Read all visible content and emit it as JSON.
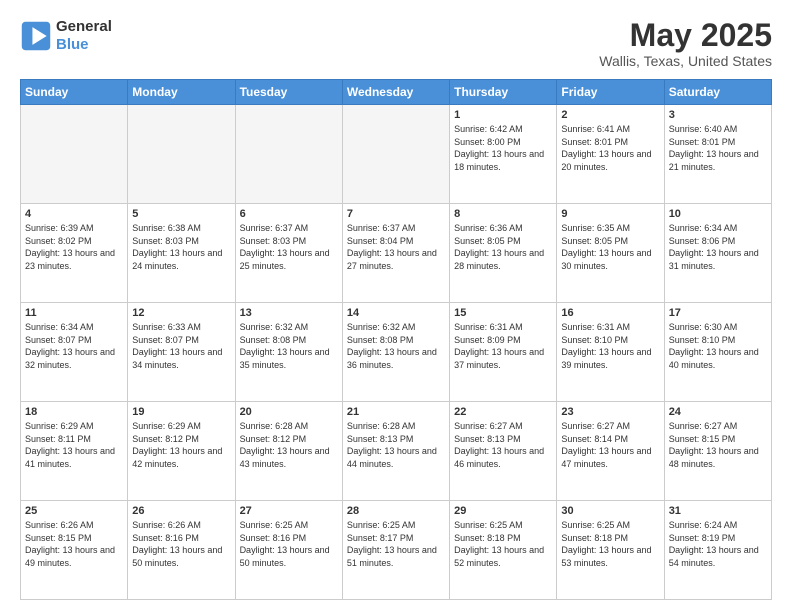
{
  "header": {
    "logo_line1": "General",
    "logo_line2": "Blue",
    "month": "May 2025",
    "location": "Wallis, Texas, United States"
  },
  "days_of_week": [
    "Sunday",
    "Monday",
    "Tuesday",
    "Wednesday",
    "Thursday",
    "Friday",
    "Saturday"
  ],
  "weeks": [
    [
      {
        "day": "",
        "sunrise": "",
        "sunset": "",
        "daylight": ""
      },
      {
        "day": "",
        "sunrise": "",
        "sunset": "",
        "daylight": ""
      },
      {
        "day": "",
        "sunrise": "",
        "sunset": "",
        "daylight": ""
      },
      {
        "day": "",
        "sunrise": "",
        "sunset": "",
        "daylight": ""
      },
      {
        "day": "1",
        "sunrise": "Sunrise: 6:42 AM",
        "sunset": "Sunset: 8:00 PM",
        "daylight": "Daylight: 13 hours and 18 minutes."
      },
      {
        "day": "2",
        "sunrise": "Sunrise: 6:41 AM",
        "sunset": "Sunset: 8:01 PM",
        "daylight": "Daylight: 13 hours and 20 minutes."
      },
      {
        "day": "3",
        "sunrise": "Sunrise: 6:40 AM",
        "sunset": "Sunset: 8:01 PM",
        "daylight": "Daylight: 13 hours and 21 minutes."
      }
    ],
    [
      {
        "day": "4",
        "sunrise": "Sunrise: 6:39 AM",
        "sunset": "Sunset: 8:02 PM",
        "daylight": "Daylight: 13 hours and 23 minutes."
      },
      {
        "day": "5",
        "sunrise": "Sunrise: 6:38 AM",
        "sunset": "Sunset: 8:03 PM",
        "daylight": "Daylight: 13 hours and 24 minutes."
      },
      {
        "day": "6",
        "sunrise": "Sunrise: 6:37 AM",
        "sunset": "Sunset: 8:03 PM",
        "daylight": "Daylight: 13 hours and 25 minutes."
      },
      {
        "day": "7",
        "sunrise": "Sunrise: 6:37 AM",
        "sunset": "Sunset: 8:04 PM",
        "daylight": "Daylight: 13 hours and 27 minutes."
      },
      {
        "day": "8",
        "sunrise": "Sunrise: 6:36 AM",
        "sunset": "Sunset: 8:05 PM",
        "daylight": "Daylight: 13 hours and 28 minutes."
      },
      {
        "day": "9",
        "sunrise": "Sunrise: 6:35 AM",
        "sunset": "Sunset: 8:05 PM",
        "daylight": "Daylight: 13 hours and 30 minutes."
      },
      {
        "day": "10",
        "sunrise": "Sunrise: 6:34 AM",
        "sunset": "Sunset: 8:06 PM",
        "daylight": "Daylight: 13 hours and 31 minutes."
      }
    ],
    [
      {
        "day": "11",
        "sunrise": "Sunrise: 6:34 AM",
        "sunset": "Sunset: 8:07 PM",
        "daylight": "Daylight: 13 hours and 32 minutes."
      },
      {
        "day": "12",
        "sunrise": "Sunrise: 6:33 AM",
        "sunset": "Sunset: 8:07 PM",
        "daylight": "Daylight: 13 hours and 34 minutes."
      },
      {
        "day": "13",
        "sunrise": "Sunrise: 6:32 AM",
        "sunset": "Sunset: 8:08 PM",
        "daylight": "Daylight: 13 hours and 35 minutes."
      },
      {
        "day": "14",
        "sunrise": "Sunrise: 6:32 AM",
        "sunset": "Sunset: 8:08 PM",
        "daylight": "Daylight: 13 hours and 36 minutes."
      },
      {
        "day": "15",
        "sunrise": "Sunrise: 6:31 AM",
        "sunset": "Sunset: 8:09 PM",
        "daylight": "Daylight: 13 hours and 37 minutes."
      },
      {
        "day": "16",
        "sunrise": "Sunrise: 6:31 AM",
        "sunset": "Sunset: 8:10 PM",
        "daylight": "Daylight: 13 hours and 39 minutes."
      },
      {
        "day": "17",
        "sunrise": "Sunrise: 6:30 AM",
        "sunset": "Sunset: 8:10 PM",
        "daylight": "Daylight: 13 hours and 40 minutes."
      }
    ],
    [
      {
        "day": "18",
        "sunrise": "Sunrise: 6:29 AM",
        "sunset": "Sunset: 8:11 PM",
        "daylight": "Daylight: 13 hours and 41 minutes."
      },
      {
        "day": "19",
        "sunrise": "Sunrise: 6:29 AM",
        "sunset": "Sunset: 8:12 PM",
        "daylight": "Daylight: 13 hours and 42 minutes."
      },
      {
        "day": "20",
        "sunrise": "Sunrise: 6:28 AM",
        "sunset": "Sunset: 8:12 PM",
        "daylight": "Daylight: 13 hours and 43 minutes."
      },
      {
        "day": "21",
        "sunrise": "Sunrise: 6:28 AM",
        "sunset": "Sunset: 8:13 PM",
        "daylight": "Daylight: 13 hours and 44 minutes."
      },
      {
        "day": "22",
        "sunrise": "Sunrise: 6:27 AM",
        "sunset": "Sunset: 8:13 PM",
        "daylight": "Daylight: 13 hours and 46 minutes."
      },
      {
        "day": "23",
        "sunrise": "Sunrise: 6:27 AM",
        "sunset": "Sunset: 8:14 PM",
        "daylight": "Daylight: 13 hours and 47 minutes."
      },
      {
        "day": "24",
        "sunrise": "Sunrise: 6:27 AM",
        "sunset": "Sunset: 8:15 PM",
        "daylight": "Daylight: 13 hours and 48 minutes."
      }
    ],
    [
      {
        "day": "25",
        "sunrise": "Sunrise: 6:26 AM",
        "sunset": "Sunset: 8:15 PM",
        "daylight": "Daylight: 13 hours and 49 minutes."
      },
      {
        "day": "26",
        "sunrise": "Sunrise: 6:26 AM",
        "sunset": "Sunset: 8:16 PM",
        "daylight": "Daylight: 13 hours and 50 minutes."
      },
      {
        "day": "27",
        "sunrise": "Sunrise: 6:25 AM",
        "sunset": "Sunset: 8:16 PM",
        "daylight": "Daylight: 13 hours and 50 minutes."
      },
      {
        "day": "28",
        "sunrise": "Sunrise: 6:25 AM",
        "sunset": "Sunset: 8:17 PM",
        "daylight": "Daylight: 13 hours and 51 minutes."
      },
      {
        "day": "29",
        "sunrise": "Sunrise: 6:25 AM",
        "sunset": "Sunset: 8:18 PM",
        "daylight": "Daylight: 13 hours and 52 minutes."
      },
      {
        "day": "30",
        "sunrise": "Sunrise: 6:25 AM",
        "sunset": "Sunset: 8:18 PM",
        "daylight": "Daylight: 13 hours and 53 minutes."
      },
      {
        "day": "31",
        "sunrise": "Sunrise: 6:24 AM",
        "sunset": "Sunset: 8:19 PM",
        "daylight": "Daylight: 13 hours and 54 minutes."
      }
    ]
  ]
}
